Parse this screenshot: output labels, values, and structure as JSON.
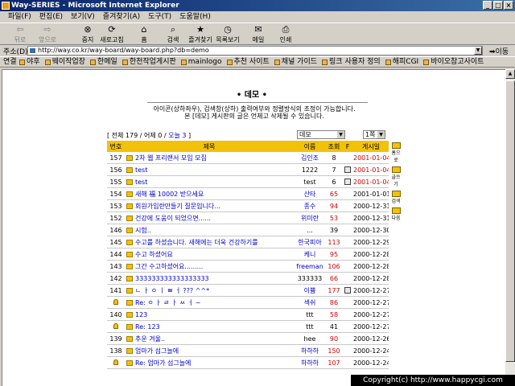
{
  "window": {
    "title": "Way-SERIES - Microsoft Internet Explorer"
  },
  "menu": [
    "파일(F)",
    "편집(E)",
    "보기(V)",
    "즐겨찾기(A)",
    "도구(T)",
    "도움말(H)"
  ],
  "toolbar": [
    {
      "label": "뒤로",
      "icon": "back-arrow-icon",
      "glyph": "⇦",
      "enabled": false
    },
    {
      "label": "앞으로",
      "icon": "forward-arrow-icon",
      "glyph": "⇨",
      "enabled": false
    },
    {
      "label": "중지",
      "icon": "stop-icon",
      "glyph": "⊗",
      "enabled": true
    },
    {
      "label": "새로고침",
      "icon": "refresh-icon",
      "glyph": "⟳",
      "enabled": true
    },
    {
      "label": "홈",
      "icon": "home-icon",
      "glyph": "⌂",
      "enabled": true
    },
    {
      "label": "검색",
      "icon": "search-icon",
      "glyph": "⌕",
      "enabled": true
    },
    {
      "label": "즐겨찾기",
      "icon": "favorites-icon",
      "glyph": "★",
      "enabled": true
    },
    {
      "label": "목록보기",
      "icon": "history-icon",
      "glyph": "◷",
      "enabled": true
    },
    {
      "label": "메일",
      "icon": "mail-icon",
      "glyph": "✉",
      "enabled": true
    },
    {
      "label": "인쇄",
      "icon": "print-icon",
      "glyph": "⎙",
      "enabled": true
    }
  ],
  "address": {
    "label": "주소(D)",
    "url": "http://way.co.kr/way-board/way-board.php?db=demo",
    "go": "이동"
  },
  "links": {
    "label": "연결",
    "items": [
      "야후",
      "웨이작업장",
      "한메일",
      "한천작업게시판",
      "mainlogo",
      "추천 사이트",
      "채널 가이드",
      "링크 사용자 정의",
      "해피CGI",
      "바이오참고사이트"
    ]
  },
  "board": {
    "title": "• 데모 •",
    "desc1": "아이콘(상하좌우), 검색창(상하) 출력여부와 정렬방식의 조정이 가능합니다.",
    "desc2": "본 [데모] 게시판의 글은 언제고 삭제될 수 있습니다.",
    "count_prefix": "[ 전체 179 / 어제 0 / ",
    "count_today": "오늘 3",
    "count_suffix": " ]",
    "select_category": "데모",
    "select_page": "1쪽",
    "columns": [
      "번호",
      "제목",
      "이름",
      "조회",
      "F",
      "게시일"
    ],
    "rows": [
      {
        "no": "157",
        "subject": "2차 웹 프리랜서 모임 모집",
        "name": "김인조",
        "views": "8",
        "file": false,
        "date": "2001-01-04",
        "reply": 0
      },
      {
        "no": "156",
        "subject": "test",
        "name": "1222",
        "views": "7",
        "file": true,
        "date": "2001-01-04",
        "reply": 0
      },
      {
        "no": "155",
        "subject": "test",
        "name": "test",
        "views": "6",
        "file": true,
        "date": "2001-01-04",
        "reply": 0
      },
      {
        "no": "154",
        "subject": "새해 福 10002 받으세요",
        "name": "산타",
        "views": "65",
        "file": false,
        "date": "2001-01-01",
        "reply": 0
      },
      {
        "no": "153",
        "subject": "회원가입란만들기 질문입니다...",
        "name": "종수",
        "views": "94",
        "file": false,
        "date": "2000-12-31",
        "reply": 0
      },
      {
        "no": "152",
        "subject": "건강에 도움이 되었으면......",
        "name": "위미란",
        "views": "53",
        "file": false,
        "date": "2000-12-31",
        "reply": 0
      },
      {
        "no": "146",
        "subject": "시험..",
        "name": "...",
        "views": "39",
        "file": false,
        "date": "2000-12-30",
        "reply": 0
      },
      {
        "no": "145",
        "subject": "수고를 하셨습니다. 새해에는 더욱 건강하기를",
        "name": "한국피아",
        "views": "113",
        "file": false,
        "date": "2000-12-29",
        "reply": 0
      },
      {
        "no": "144",
        "subject": "수고 하셨어요",
        "name": "케니",
        "views": "95",
        "file": false,
        "date": "2000-12-28",
        "reply": 0
      },
      {
        "no": "143",
        "subject": "그간 수고하셨어요.........",
        "name": "freeman",
        "views": "106",
        "file": false,
        "date": "2000-12-28",
        "reply": 0
      },
      {
        "no": "142",
        "subject": "333333333333333333",
        "name": "333333",
        "views": "66",
        "file": false,
        "date": "2000-12-28",
        "reply": 0
      },
      {
        "no": "141",
        "subject": "ㄴ ㅏ ㅇ ㅣ ㅃ ㅓ ??? ^^*",
        "name": "이쁑",
        "views": "177",
        "file": true,
        "date": "2000-12-27",
        "reply": 0
      },
      {
        "no": "",
        "subject": "Re: ㅇ ㅏ ㄹ ㅏ ㅆ ㅓ ~",
        "name": "섹쉬",
        "views": "86",
        "file": false,
        "date": "2000-12-27",
        "reply": 1
      },
      {
        "no": "140",
        "subject": "123",
        "name": "ttt",
        "views": "58",
        "file": false,
        "date": "2000-12-27",
        "reply": 0
      },
      {
        "no": "",
        "subject": "Re: 123",
        "name": "ttt",
        "views": "41",
        "file": false,
        "date": "2000-12-27",
        "reply": 1
      },
      {
        "no": "139",
        "subject": "추운 겨울..",
        "name": "hee",
        "views": "90",
        "file": false,
        "date": "2000-12-26",
        "reply": 0
      },
      {
        "no": "138",
        "subject": "엄마가 섬그늘에",
        "name": "하하하",
        "views": "150",
        "file": false,
        "date": "2000-12-24",
        "reply": 0
      },
      {
        "no": "",
        "subject": "Re: 엄마가 섬그늘에",
        "name": "하하하",
        "views": "107",
        "file": false,
        "date": "2000-12-24",
        "reply": 1
      }
    ],
    "side_icons": [
      {
        "label": "홈으로",
        "icon": "home-icon"
      },
      {
        "label": "글쓰기",
        "icon": "write-icon"
      },
      {
        "label": "검색",
        "icon": "search-icon"
      },
      {
        "label": "다음",
        "icon": "next-page-icon"
      }
    ]
  },
  "copyright": "Copyright(c) http://www.happycgi.com"
}
